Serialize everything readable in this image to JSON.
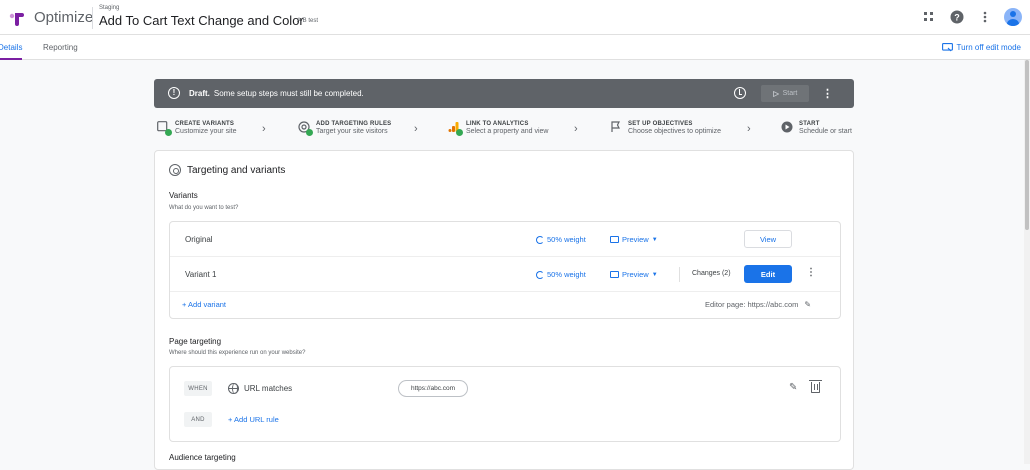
{
  "header": {
    "app_name": "Optimize",
    "container": "Staging",
    "title": "Add To Cart Text Change and Color",
    "type_badge": "A/B test",
    "icons": [
      "apps-icon",
      "help-icon",
      "more-vert-icon",
      "avatar"
    ]
  },
  "tabs": [
    {
      "label": "Details",
      "active": true
    },
    {
      "label": "Reporting",
      "active": false
    }
  ],
  "edit_mode_label": "Turn off edit mode",
  "draft": {
    "status": "Draft.",
    "message": "Some setup steps must still be completed.",
    "start_label": "Start"
  },
  "steps": [
    {
      "title": "CREATE VARIANTS",
      "subtitle": "Customize your site",
      "icon": "variants-icon",
      "complete": true
    },
    {
      "title": "ADD TARGETING RULES",
      "subtitle": "Target your site visitors",
      "icon": "targeting-icon",
      "complete": true
    },
    {
      "title": "LINK TO ANALYTICS",
      "subtitle": "Select a property and view",
      "icon": "analytics-icon",
      "complete": true
    },
    {
      "title": "SET UP OBJECTIVES",
      "subtitle": "Choose objectives to optimize",
      "icon": "flag-icon",
      "complete": false
    },
    {
      "title": "START",
      "subtitle": "Schedule or start",
      "icon": "play-icon",
      "complete": false
    }
  ],
  "card": {
    "title": "Targeting and variants",
    "variants": {
      "title": "Variants",
      "subtitle": "What do you want to test?",
      "rows": [
        {
          "name": "Original",
          "weight": "50% weight",
          "preview": "Preview",
          "changes": "",
          "action": "View"
        },
        {
          "name": "Variant 1",
          "weight": "50% weight",
          "preview": "Preview",
          "changes": "Changes (2)",
          "action": "Edit"
        }
      ],
      "add_label": "+ Add variant",
      "editor_page": "Editor page: https://abc.com"
    },
    "page_targeting": {
      "title": "Page targeting",
      "subtitle": "Where should this experience run on your website?",
      "when_chip": "WHEN",
      "rule_label": "URL matches",
      "rule_value": "https://abc.com",
      "and_chip": "AND",
      "add_rule_label": "+ Add URL rule"
    },
    "audience_targeting": {
      "title": "Audience targeting"
    }
  },
  "colors": {
    "accent": "#1a73e8",
    "tab_indicator": "#7b1fa2",
    "draft_bar": "#5f6368",
    "complete": "#34a853"
  }
}
